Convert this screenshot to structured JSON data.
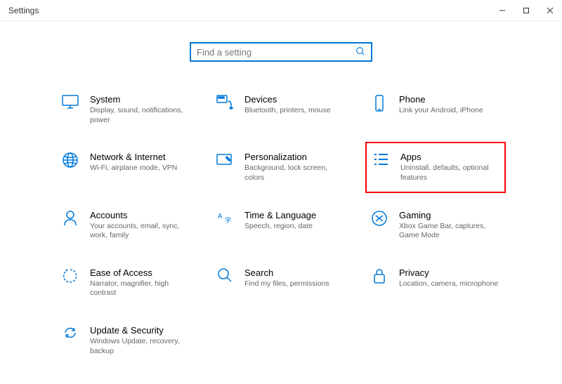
{
  "window": {
    "title": "Settings"
  },
  "search": {
    "placeholder": "Find a setting"
  },
  "tiles": [
    {
      "id": "system",
      "title": "System",
      "desc": "Display, sound, notifications, power"
    },
    {
      "id": "devices",
      "title": "Devices",
      "desc": "Bluetooth, printers, mouse"
    },
    {
      "id": "phone",
      "title": "Phone",
      "desc": "Link your Android, iPhone"
    },
    {
      "id": "network",
      "title": "Network & Internet",
      "desc": "Wi-Fi, airplane mode, VPN"
    },
    {
      "id": "personalization",
      "title": "Personalization",
      "desc": "Background, lock screen, colors"
    },
    {
      "id": "apps",
      "title": "Apps",
      "desc": "Uninstall, defaults, optional features",
      "highlight": true
    },
    {
      "id": "accounts",
      "title": "Accounts",
      "desc": "Your accounts, email, sync, work, family"
    },
    {
      "id": "time-language",
      "title": "Time & Language",
      "desc": "Speech, region, date"
    },
    {
      "id": "gaming",
      "title": "Gaming",
      "desc": "Xbox Game Bar, captures, Game Mode"
    },
    {
      "id": "ease-of-access",
      "title": "Ease of Access",
      "desc": "Narrator, magnifier, high contrast"
    },
    {
      "id": "search-cat",
      "title": "Search",
      "desc": "Find my files, permissions"
    },
    {
      "id": "privacy",
      "title": "Privacy",
      "desc": "Location, camera, microphone"
    },
    {
      "id": "update-security",
      "title": "Update & Security",
      "desc": "Windows Update, recovery, backup"
    }
  ]
}
